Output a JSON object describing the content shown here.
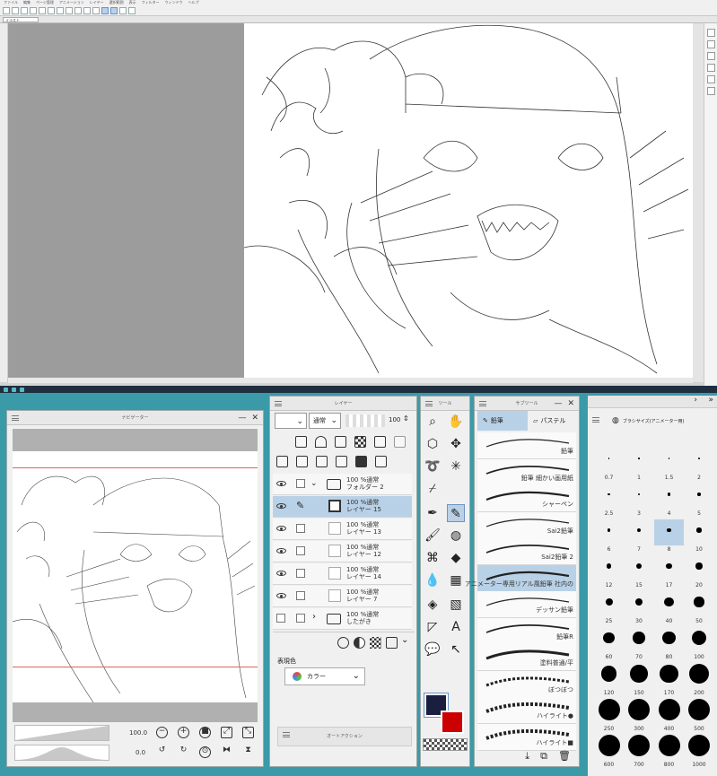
{
  "app": {
    "menu": [
      "ファイル",
      "編集",
      "ページ管理",
      "アニメーション",
      "レイヤー",
      "選択範囲",
      "表示",
      "フィルター",
      "ウィンドウ",
      "ヘルプ"
    ],
    "file_tab": "イラスト"
  },
  "navigator": {
    "title": "ナビゲーター",
    "zoom": "100.0",
    "rotation": "0.0"
  },
  "layer_panel": {
    "title": "レイヤー",
    "blend_mode": "通常",
    "opacity": "100",
    "layers": [
      {
        "line1": "100 %通常",
        "line2": "フォルダー 2",
        "selected": false
      },
      {
        "line1": "100 %通常",
        "line2": "レイヤー 15",
        "selected": true
      },
      {
        "line1": "100 %通常",
        "line2": "レイヤー 13",
        "selected": false
      },
      {
        "line1": "100 %通常",
        "line2": "レイヤー 12",
        "selected": false
      },
      {
        "line1": "100 %通常",
        "line2": "レイヤー 14",
        "selected": false
      },
      {
        "line1": "100 %通常",
        "line2": "レイヤー 7",
        "selected": false
      },
      {
        "line1": "100 %通常",
        "line2": "したがき",
        "selected": false
      }
    ],
    "expression_label": "表現色",
    "expression_value": "カラー",
    "auto_action_title": "オートアクション"
  },
  "tool_panel": {
    "title": "ツール"
  },
  "sub_tool": {
    "title": "サブツール",
    "tabs": [
      "鉛筆",
      "パステル"
    ],
    "brushes": [
      "鉛筆",
      "鉛筆 細かい画用紙",
      "シャーペン",
      "Sai2鉛筆",
      "Sai2鉛筆 2",
      "アニメーター専用リアル風鉛筆 社内の",
      "デッサン鉛筆",
      "鉛筆R",
      "塗料普通/平",
      "ぼつぼつ",
      "ハイライト●",
      "ハイライト■"
    ]
  },
  "brush_size": {
    "title": "ブラシサイズ(アニメーター用)",
    "sizes": [
      "0.7",
      "1",
      "1.5",
      "2",
      "2.5",
      "3",
      "4",
      "5",
      "6",
      "7",
      "8",
      "10",
      "12",
      "15",
      "17",
      "20",
      "25",
      "30",
      "40",
      "50",
      "60",
      "70",
      "80",
      "100",
      "120",
      "150",
      "170",
      "200",
      "250",
      "300",
      "400",
      "500",
      "600",
      "700",
      "800",
      "1000"
    ],
    "selected": "8"
  },
  "colors": {
    "main": "#1b1f3f",
    "sub": "#cc0000",
    "selection": "#b9d1e6"
  }
}
